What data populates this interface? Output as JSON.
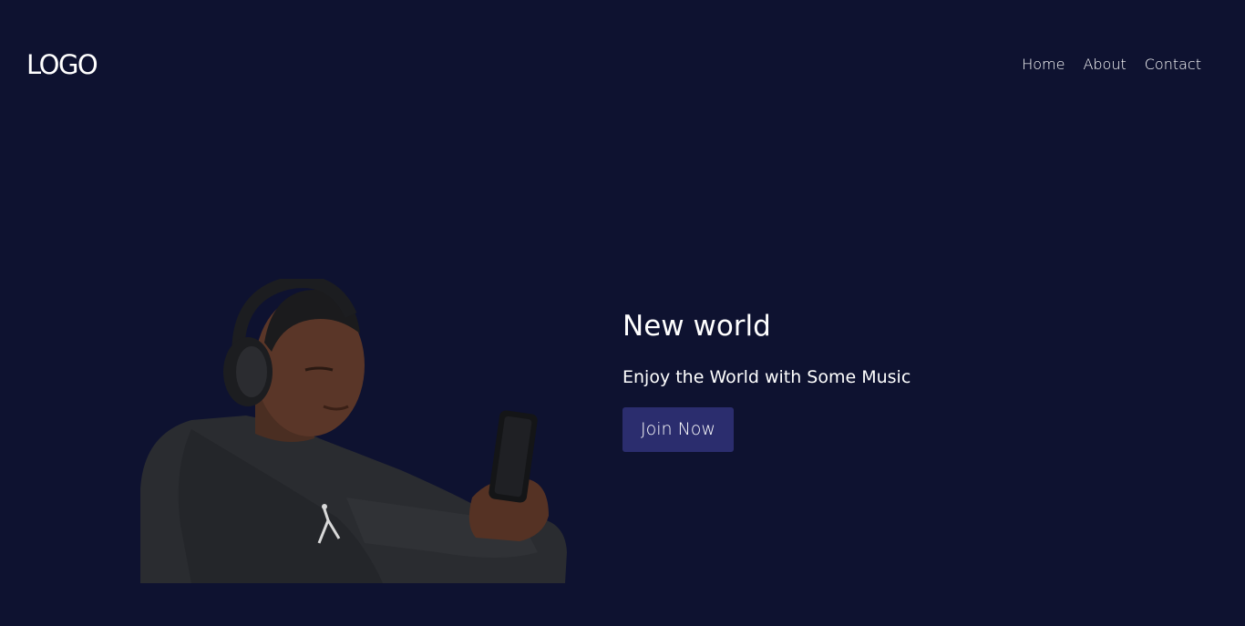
{
  "header": {
    "logo": "LOGO",
    "nav": [
      {
        "label": "Home"
      },
      {
        "label": "About"
      },
      {
        "label": "Contact"
      }
    ]
  },
  "hero": {
    "title": "New world",
    "subtitle": "Enjoy the World with Some Music",
    "cta_label": "Join Now"
  },
  "colors": {
    "background": "#0e1230",
    "button": "#2b2d6e",
    "text": "#ffffff"
  }
}
